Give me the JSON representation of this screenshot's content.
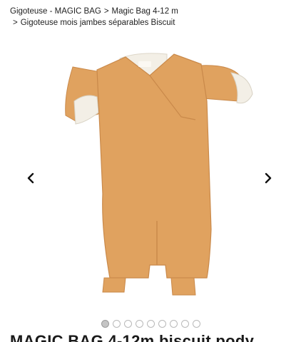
{
  "breadcrumb": {
    "items": [
      "Gigoteuse - MAGIC BAG",
      "Magic Bag 4-12 m",
      "Gigoteuse mois jambes séparables Biscuit"
    ],
    "separator": ">"
  },
  "gallery": {
    "image_alt": "product-photo-sleeping-bag",
    "dot_count": 9,
    "active_index": 0
  },
  "product": {
    "title": "MAGIC BAG 4-12m biscuit pody"
  },
  "colors": {
    "garment": "#e0a25f",
    "garment_shadow": "#c9894a",
    "lining": "#f3efe6"
  }
}
